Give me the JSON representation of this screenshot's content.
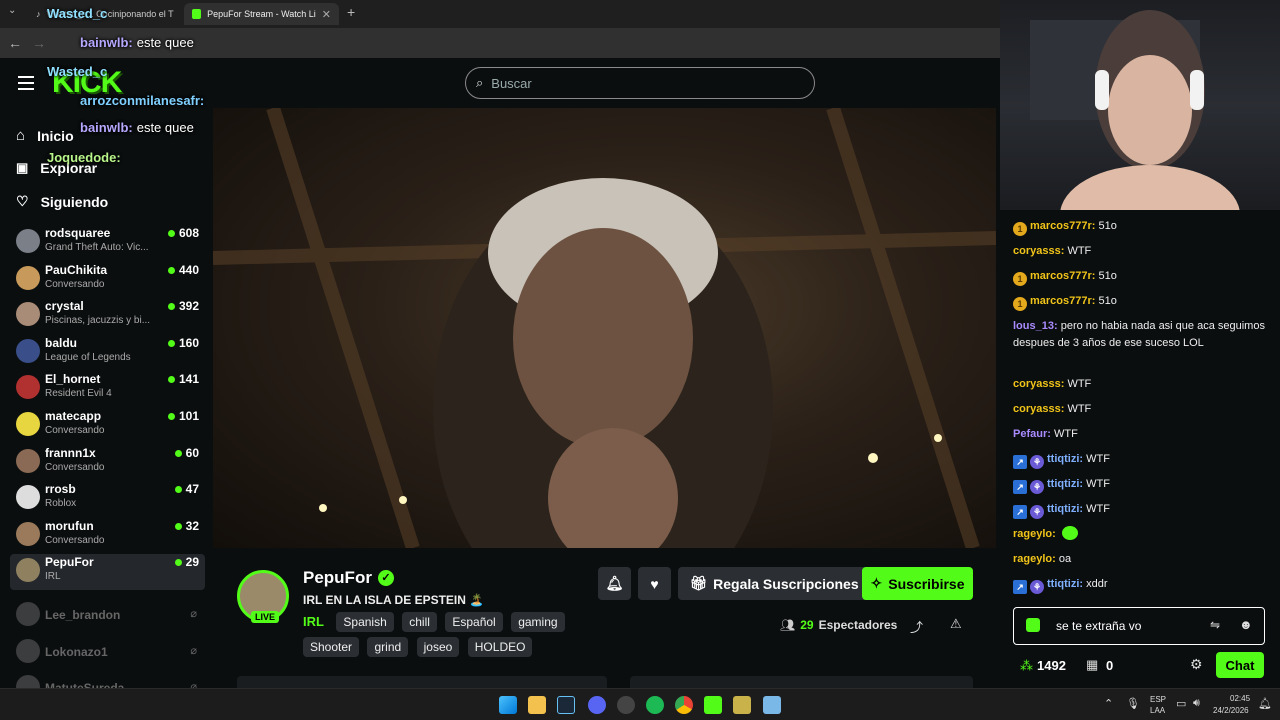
{
  "browser": {
    "tabs": [
      {
        "title": "Wasted_c... Cociniponando el T"
      },
      {
        "title": "PepuFor Stream - Watch Li"
      }
    ],
    "new_tab": "+"
  },
  "header": {
    "logo": "KICK",
    "search_placeholder": "Buscar"
  },
  "sidebar": {
    "nav": [
      {
        "label": "Inicio"
      },
      {
        "label": "Explorar"
      },
      {
        "label": "Siguiendo"
      }
    ],
    "channels": [
      {
        "name": "rodsquaree",
        "category": "Grand Theft Auto: Vic...",
        "viewers": "608",
        "color": "#7a7f88"
      },
      {
        "name": "PauChikita",
        "category": "Conversando",
        "viewers": "440",
        "color": "#c79a5b"
      },
      {
        "name": "crystal",
        "category": "Piscinas, jacuzzis y bi...",
        "viewers": "392",
        "color": "#a98c78"
      },
      {
        "name": "baldu",
        "category": "League of Legends",
        "viewers": "160",
        "color": "#3a4f8a"
      },
      {
        "name": "El_hornet",
        "category": "Resident Evil 4",
        "viewers": "141",
        "color": "#b13030"
      },
      {
        "name": "matecapp",
        "category": "Conversando",
        "viewers": "101",
        "color": "#e8d640"
      },
      {
        "name": "frannn1x",
        "category": "Conversando",
        "viewers": "60",
        "color": "#8a6a55"
      },
      {
        "name": "rrosb",
        "category": "Roblox",
        "viewers": "47",
        "color": "#dddddd"
      },
      {
        "name": "morufun",
        "category": "Conversando",
        "viewers": "32",
        "color": "#9a7a5a"
      },
      {
        "name": "PepuFor",
        "category": "IRL",
        "viewers": "29",
        "color": "#8f8060"
      }
    ],
    "offline": [
      {
        "name": "Lee_brandon"
      },
      {
        "name": "Lokonazo1"
      },
      {
        "name": "MatuteSureda"
      }
    ]
  },
  "overlay_chat": [
    {
      "user": "Wasted_c",
      "text": "",
      "color": "#8fe0ff"
    },
    {
      "user": "bainwlb:",
      "text": "este quee",
      "color": "#b7a8ff"
    },
    {
      "user": "Wasted_c",
      "text": "",
      "color": "#8fe0ff"
    },
    {
      "user": "arrozconmilanesafr:",
      "text": "",
      "color": "#7fd0ff"
    },
    {
      "user": "bainwlb:",
      "text": "este quee",
      "color": "#b7a8ff"
    },
    {
      "user": "Joquedode:",
      "text": "",
      "color": "#b8f58a"
    }
  ],
  "stream": {
    "streamer": "PepuFor",
    "title": "IRL EN LA ISLA DE EPSTEIN 🏝️",
    "category": "IRL",
    "tags": [
      "Spanish",
      "chill",
      "Español",
      "gaming",
      "Shooter",
      "grind",
      "joseo",
      "HOLDEO"
    ],
    "live_label": "LIVE",
    "gift_label": "Regala Suscripciones",
    "subscribe_label": "Suscribirse",
    "viewers": "29",
    "viewers_label": "Espectadores"
  },
  "chat": {
    "messages": [
      {
        "user": "marcos777r:",
        "text": "51o",
        "color": "#f0c419",
        "badge": "gold"
      },
      {
        "user": "coryasss:",
        "text": "WTF",
        "color": "#f0c419",
        "badge": ""
      },
      {
        "user": "marcos777r:",
        "text": "51o",
        "color": "#f0c419",
        "badge": "gold"
      },
      {
        "user": "marcos777r:",
        "text": "51o",
        "color": "#f0c419",
        "badge": "gold"
      },
      {
        "user": "lous_13:",
        "text": "pero no habia nada asi que aca seguimos despues de 3 años de ese suceso LOL",
        "color": "#a98bff",
        "badge": ""
      },
      {
        "user": "coryasss:",
        "text": "WTF",
        "color": "#f0c419",
        "badge": ""
      },
      {
        "user": "coryasss:",
        "text": "WTF",
        "color": "#f0c419",
        "badge": ""
      },
      {
        "user": "Pefaur:",
        "text": "WTF",
        "color": "#a98bff",
        "badge": ""
      },
      {
        "user": "ttiqtizi:",
        "text": "WTF",
        "color": "#7fb0ff",
        "badge": "blue"
      },
      {
        "user": "ttiqtizi:",
        "text": "WTF",
        "color": "#7fb0ff",
        "badge": "blue"
      },
      {
        "user": "ttiqtizi:",
        "text": "WTF",
        "color": "#7fb0ff",
        "badge": "blue"
      },
      {
        "user": "rageylo:",
        "text": "",
        "color": "#f0c419",
        "badge": ""
      },
      {
        "user": "rageylo:",
        "text": "oa",
        "color": "#f0c419",
        "badge": ""
      },
      {
        "user": "ttiqtizi:",
        "text": "xddr",
        "color": "#7fb0ff",
        "badge": "blue"
      }
    ],
    "input_value": "se te extraña vo",
    "points": "1492",
    "drops": "0",
    "send_label": "Chat"
  },
  "taskbar": {
    "lang": "ESP",
    "lang_sub": "LAA",
    "time": "02:45",
    "date": "24/2/2026"
  },
  "colors": {
    "accent": "#53fc18",
    "bg": "#0b0e0f"
  }
}
